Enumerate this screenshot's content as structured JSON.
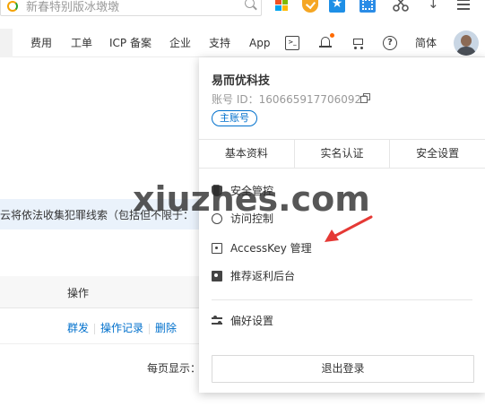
{
  "browser": {
    "address_placeholder": "新春特别版冰墩墩",
    "icons": [
      "search-icon",
      "windows-icon",
      "shield-icon",
      "star-icon",
      "qr-icon",
      "scissor-icon",
      "download-icon",
      "menu-icon"
    ]
  },
  "topnav": {
    "links": [
      "费用",
      "工单",
      "ICP 备案",
      "企业",
      "支持",
      "App"
    ],
    "lang": "简体",
    "accent": "#ff6a00",
    "icons": [
      "terminal-icon",
      "bell-icon",
      "cart-icon",
      "help-icon",
      "avatar"
    ]
  },
  "page": {
    "notice_text": "云将依法收集犯罪线索（包括但不限于：",
    "column_ops": "操作",
    "row_actions": [
      "群发",
      "操作记录",
      "删除"
    ],
    "page_size_label": "每页显示："
  },
  "user_panel": {
    "company": "易而优科技",
    "account_id": "账号 ID：1606659177060922",
    "badge": "主账号",
    "tabs": [
      "基本资料",
      "实名认证",
      "安全设置"
    ],
    "menu": [
      "安全管控",
      "访问控制",
      "AccessKey 管理",
      "推荐返利后台"
    ],
    "preferences": "偏好设置",
    "logout": "退出登录",
    "link_color": "#0070cc"
  },
  "overlay": {
    "watermark": "xiuzhes.com",
    "arrow_color": "#e53935"
  }
}
